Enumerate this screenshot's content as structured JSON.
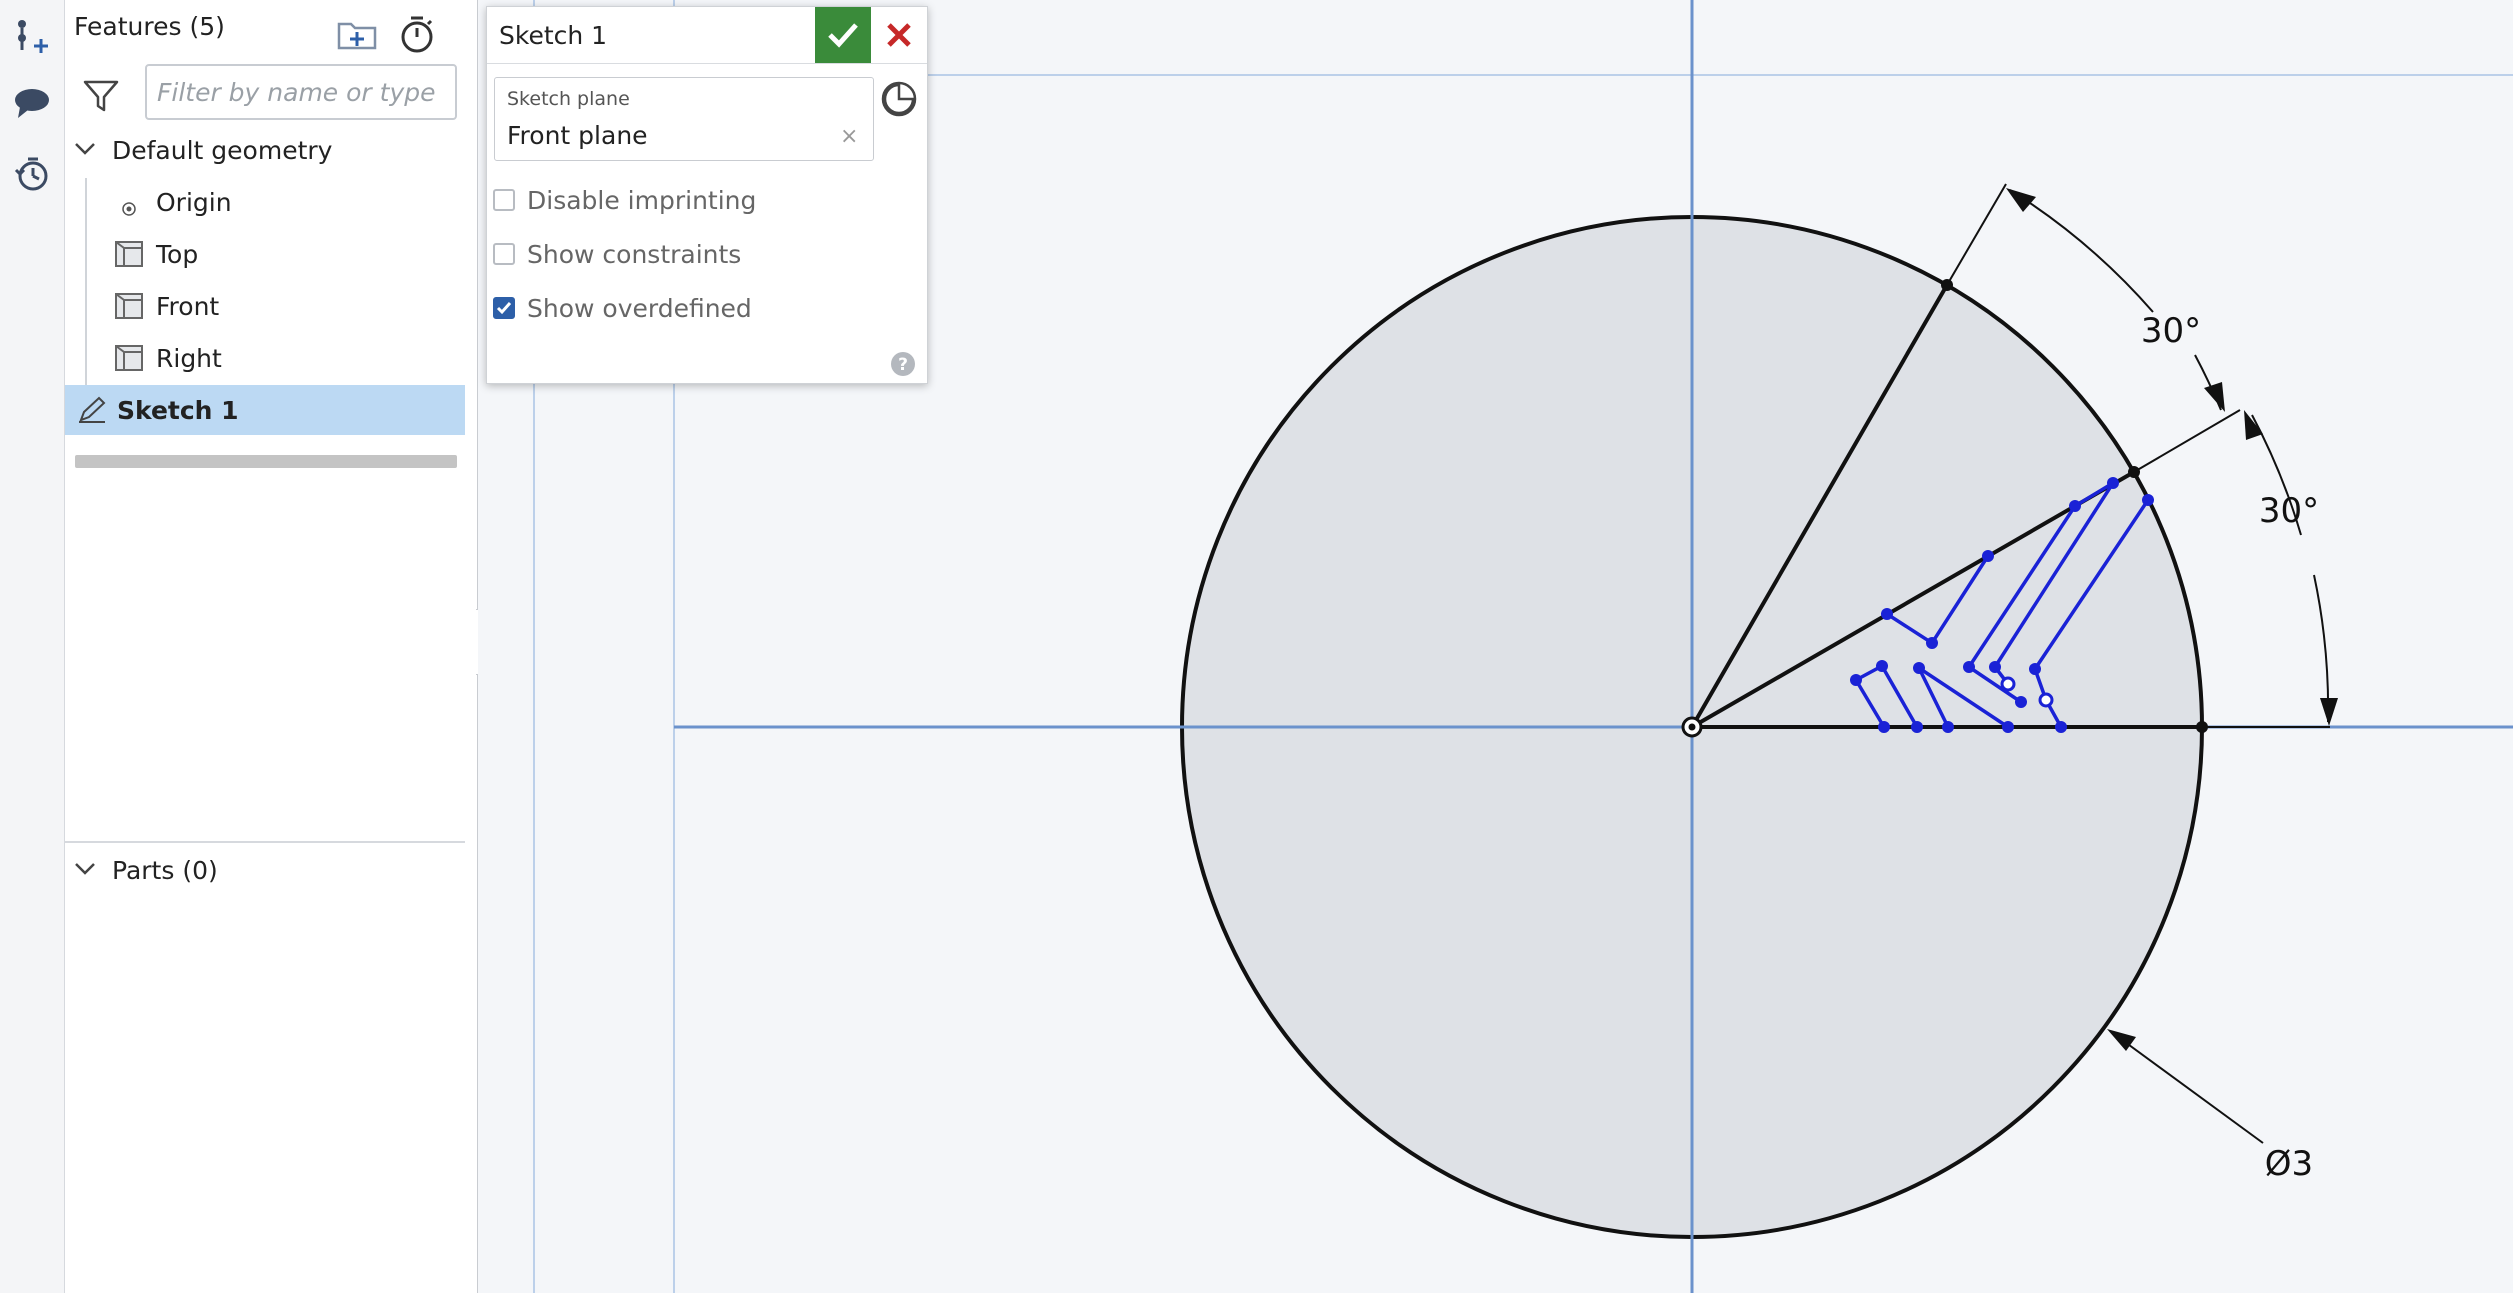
{
  "features": {
    "header": "Features (5)",
    "filter_placeholder": "Filter by name or type",
    "default_geometry": "Default geometry",
    "origin": "Origin",
    "planes": [
      "Top",
      "Front",
      "Right"
    ],
    "sketch": "Sketch 1",
    "parts": "Parts (0)"
  },
  "dialog": {
    "title": "Sketch 1",
    "plane_caption": "Sketch plane",
    "plane_value": "Front plane",
    "plane_clear": "×",
    "options": [
      {
        "label": "Disable imprinting",
        "checked": false
      },
      {
        "label": "Show constraints",
        "checked": false
      },
      {
        "label": "Show overdefined",
        "checked": true
      }
    ],
    "help": "?"
  },
  "canvas": {
    "angle_dim_1": "30°",
    "angle_dim_2": "30°",
    "diameter_dim": "Ø3"
  },
  "colors": {
    "accent": "#2d5fa8",
    "confirm": "#3a8b3a",
    "cancel": "#c62828",
    "selection": "#bcd9f3",
    "sketch_blue": "#1a22d6"
  }
}
